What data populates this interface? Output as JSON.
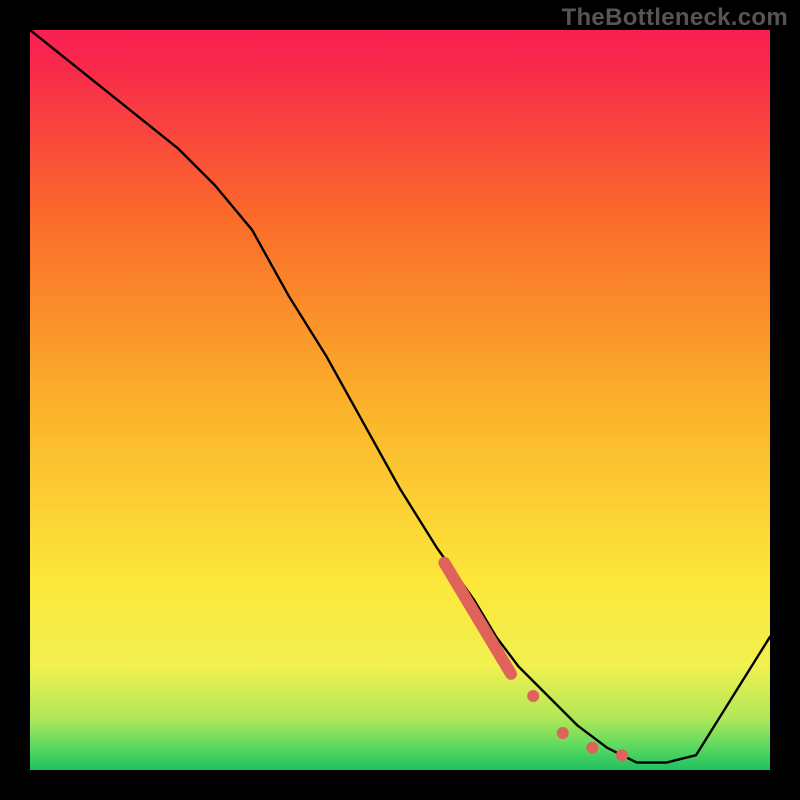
{
  "watermark": "TheBottleneck.com",
  "chart_data": {
    "type": "line",
    "title": "",
    "xlabel": "",
    "ylabel": "",
    "xlim": [
      0,
      100
    ],
    "ylim": [
      0,
      100
    ],
    "series": [
      {
        "name": "curve",
        "x": [
          0,
          5,
          10,
          15,
          20,
          25,
          30,
          35,
          40,
          45,
          50,
          55,
          60,
          63,
          66,
          70,
          74,
          78,
          82,
          86,
          90,
          95,
          100
        ],
        "values": [
          100,
          96,
          92,
          88,
          84,
          79,
          73,
          64,
          56,
          47,
          38,
          30,
          23,
          18,
          14,
          10,
          6,
          3,
          1,
          1,
          2,
          10,
          18
        ]
      }
    ],
    "markers": [
      {
        "name": "streak-start",
        "x": 56,
        "y": 28
      },
      {
        "name": "streak-end",
        "x": 65,
        "y": 13
      },
      {
        "name": "dot-1",
        "x": 68,
        "y": 10
      },
      {
        "name": "dot-2",
        "x": 72,
        "y": 5
      },
      {
        "name": "dot-3",
        "x": 76,
        "y": 3
      },
      {
        "name": "dot-4",
        "x": 80,
        "y": 2
      }
    ],
    "colors": {
      "curve": "#000000",
      "marker": "#e0635a"
    }
  }
}
